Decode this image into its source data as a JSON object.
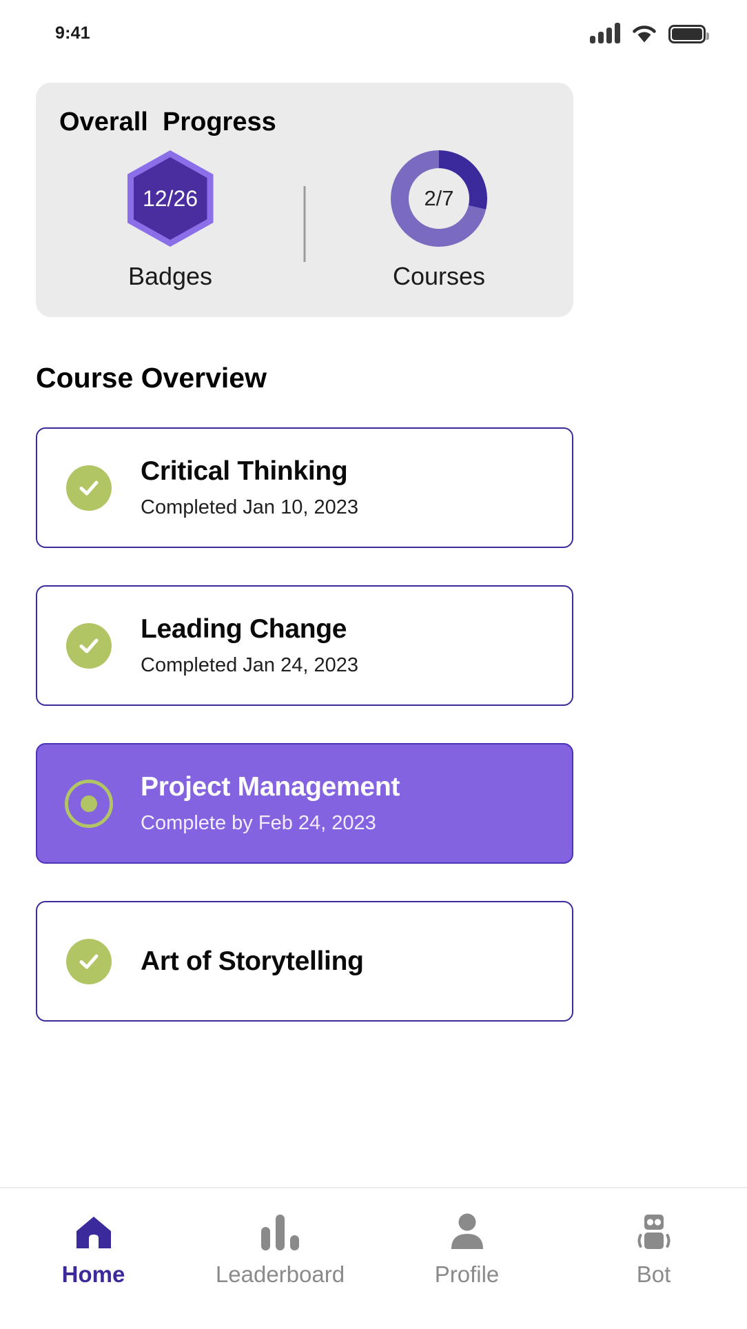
{
  "status_bar": {
    "time": "9:41",
    "icons": [
      "cellular-signal-icon",
      "wifi-icon",
      "battery-icon"
    ]
  },
  "overall_progress": {
    "title": "Overall  Progress",
    "badges": {
      "value": "12/26",
      "label": "Badges",
      "icon": "hexagon-badge-icon"
    },
    "courses": {
      "value": "2/7",
      "label": "Courses",
      "icon": "donut-progress-icon",
      "completed": 2,
      "total": 7
    }
  },
  "course_overview": {
    "title": "Course Overview",
    "cards": [
      {
        "title": "Critical Thinking",
        "subtitle": "Completed Jan 10, 2023",
        "icon": "check-circle-icon",
        "state": "completed"
      },
      {
        "title": "Leading Change",
        "subtitle": "Completed Jan 24, 2023",
        "icon": "check-circle-icon",
        "state": "completed"
      },
      {
        "title": "Project Management",
        "subtitle": "Complete by Feb 24, 2023",
        "icon": "ring-dot-icon",
        "state": "active"
      },
      {
        "title": "Art of Storytelling",
        "subtitle": "",
        "icon": "check-circle-icon",
        "state": "upcoming"
      }
    ]
  },
  "bottom_nav": {
    "items": [
      {
        "label": "Home",
        "icon": "home-icon",
        "active": true
      },
      {
        "label": "Leaderboard",
        "icon": "bar-chart-icon",
        "active": false
      },
      {
        "label": "Profile",
        "icon": "person-icon",
        "active": false
      },
      {
        "label": "Bot",
        "icon": "robot-icon",
        "active": false
      }
    ]
  },
  "colors": {
    "brand_indigo": "#3b2a9b",
    "accent_purple": "#8463e0",
    "hex_light": "#8a6fe8",
    "hex_dark": "#4a2ea0",
    "green": "#b1c565",
    "card_bg": "#ebebeb",
    "muted": "#8a8a8a"
  }
}
